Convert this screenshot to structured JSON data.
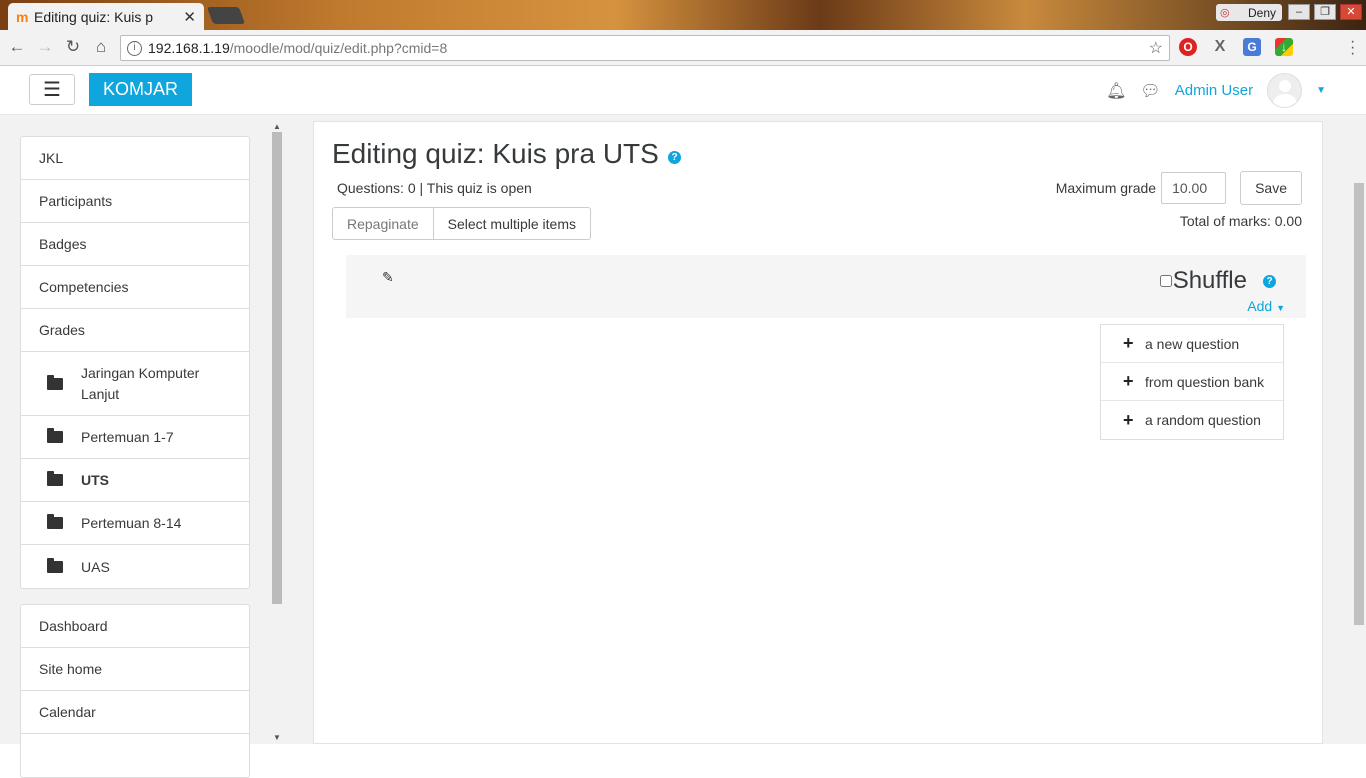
{
  "browser": {
    "tab_title": "Editing quiz: Kuis p",
    "tab_favicon": "moodle-favicon-icon",
    "profile_name": "Deny",
    "url_host": "192.168.1.19",
    "url_path": "/moodle/mod/quiz/edit.php?cmid=8"
  },
  "navbar": {
    "brand": "KOMJAR",
    "user_name": "Admin User"
  },
  "sidebar": {
    "course_items": [
      {
        "label": "JKL"
      },
      {
        "label": "Participants"
      },
      {
        "label": "Badges"
      },
      {
        "label": "Competencies"
      },
      {
        "label": "Grades"
      },
      {
        "label": "Jaringan Komputer Lanjut",
        "icon": "folder-icon"
      },
      {
        "label": "Pertemuan 1-7",
        "icon": "folder-icon"
      },
      {
        "label": "UTS",
        "icon": "folder-icon",
        "active": true
      },
      {
        "label": "Pertemuan 8-14",
        "icon": "folder-icon"
      },
      {
        "label": "UAS",
        "icon": "folder-icon"
      }
    ],
    "site_items": [
      {
        "label": "Dashboard"
      },
      {
        "label": "Site home"
      },
      {
        "label": "Calendar"
      }
    ]
  },
  "main": {
    "title": "Editing quiz: Kuis pra UTS",
    "status": "Questions: 0 | This quiz is open",
    "max_grade_label": "Maximum grade",
    "max_grade_value": "10.00",
    "save_label": "Save",
    "total_marks": "Total of marks: 0.00",
    "repaginate_label": "Repaginate",
    "select_multiple_label": "Select multiple items",
    "shuffle_label": "Shuffle",
    "add_label": "Add",
    "add_menu": [
      {
        "label": "a new question"
      },
      {
        "label": "from question bank"
      },
      {
        "label": "a random question"
      }
    ]
  },
  "colors": {
    "accent": "#0ea6dc"
  }
}
